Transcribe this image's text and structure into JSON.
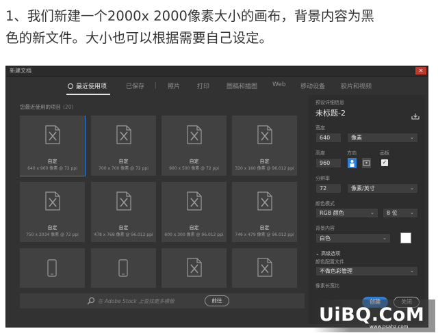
{
  "caption": {
    "line1": "1、我们新建一个2000x 2000像素大小的画布，背景内容为黑",
    "line2": "色的新文件。大小也可以根据需要自己设定。"
  },
  "dialog": {
    "title": "新建文档",
    "tabs": [
      {
        "label": "最近使用项",
        "active": true
      },
      {
        "label": "已保存"
      },
      {
        "label": "照片"
      },
      {
        "label": "打印"
      },
      {
        "label": "图稿和插图"
      },
      {
        "label": "Web"
      },
      {
        "label": "移动设备"
      },
      {
        "label": "胶片和视频"
      }
    ],
    "recent_label": "您最近使用的项目",
    "recent_count": "(20)",
    "cards": [
      {
        "name": "自定",
        "dims": "640 x 960 像素 @ 72 ppi",
        "selected": true,
        "icon": "document-icon"
      },
      {
        "name": "自定",
        "dims": "700 x 700 像素 @ 72 ppi",
        "icon": "document-icon"
      },
      {
        "name": "自定",
        "dims": "900 x 500 像素 @ 72 ppi",
        "icon": "document-icon"
      },
      {
        "name": "自定",
        "dims": "320 x 160 像素 @ 96.012 ppi",
        "icon": "document-icon"
      },
      {
        "name": "自定",
        "dims": "750 x 2034 像素 @ 72 ppi",
        "icon": "document-icon"
      },
      {
        "name": "自定",
        "dims": "478 x 768 像素 @ 96.012 ppi",
        "icon": "document-icon"
      },
      {
        "name": "自定",
        "dims": "600 x 300 像素 @ 96.012 ppi",
        "icon": "document-icon"
      },
      {
        "name": "自定",
        "dims": "746 x 479 像素 @ 96.012 ppi",
        "icon": "document-icon"
      },
      {
        "name": "",
        "dims": "",
        "icon": "phone-icon"
      },
      {
        "name": "",
        "dims": "",
        "icon": "phone-icon"
      },
      {
        "name": "",
        "dims": "",
        "icon": "document-icon"
      },
      {
        "name": "",
        "dims": "",
        "icon": "document-icon"
      }
    ],
    "search": {
      "placeholder": "在 Adobe Stock 上查找更多模板",
      "go_label": "前往"
    },
    "preset": {
      "section_label": "预设详细信息",
      "doc_name": "未标题-2",
      "width_label": "宽度",
      "width_value": "640",
      "width_unit": "像素",
      "height_label": "高度",
      "height_value": "960",
      "orientation_label": "方向",
      "artboard_label": "画板",
      "artboard_checked": true,
      "resolution_label": "分辨率",
      "resolution_value": "72",
      "resolution_unit": "像素/英寸",
      "color_mode_label": "颜色模式",
      "color_mode_value": "RGB 颜色",
      "bit_depth": "8 位",
      "background_label": "背景内容",
      "background_value": "白色",
      "background_color": "#ffffff",
      "advanced_label": "高级选项",
      "color_profile_label": "颜色配置文件",
      "color_profile_value": "不做色彩管理",
      "pixel_aspect_label": "像素长宽比",
      "create_label": "创建",
      "close_label": "关闭"
    }
  },
  "watermark": {
    "logo": "UiBQ.CoM",
    "url": "www.psahz.com"
  }
}
